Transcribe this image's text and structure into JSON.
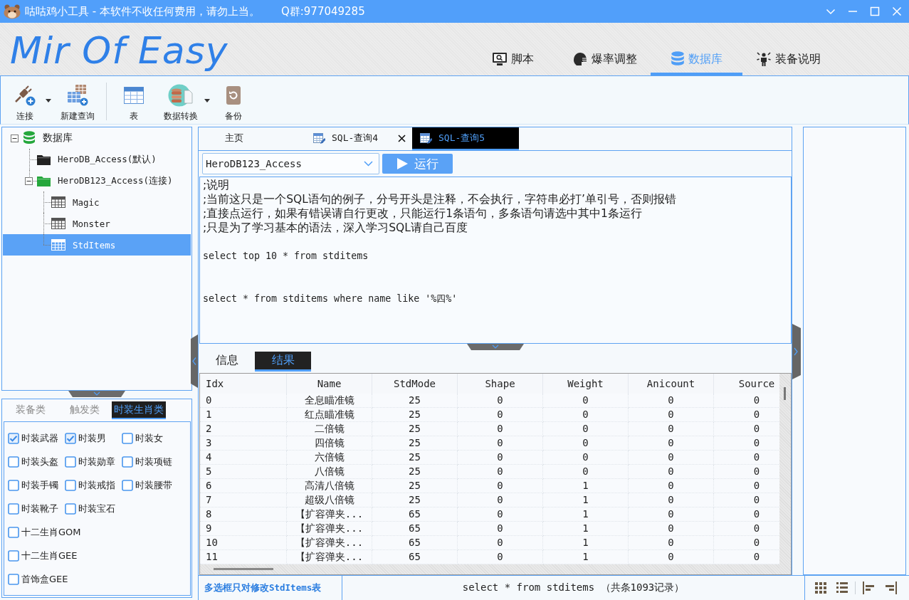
{
  "window": {
    "title": "咕咕鸡小工具 - 本软件不收任何费用，请勿上当。",
    "contact": "Q群:977049285"
  },
  "header": {
    "logo": "Mir Of Easy",
    "tabs": [
      {
        "label": "脚本",
        "selected": false
      },
      {
        "label": "爆率调整",
        "selected": false
      },
      {
        "label": "数据库",
        "selected": true
      },
      {
        "label": "装备说明",
        "selected": false
      }
    ]
  },
  "toolbar": {
    "groups": [
      [
        {
          "label": "连接",
          "dropdown": true
        },
        {
          "label": "新建查询",
          "dropdown": false
        }
      ],
      [
        {
          "label": "表",
          "dropdown": false
        },
        {
          "label": "数据转换",
          "dropdown": true
        },
        {
          "label": "备份",
          "dropdown": false
        }
      ]
    ]
  },
  "tree": [
    {
      "label": "数据库",
      "kind": "database",
      "expanded": true,
      "selected": false,
      "children": [
        {
          "label": "HeroDB_Access(默认)",
          "kind": "folder",
          "connected": false,
          "selected": false
        },
        {
          "label": "HeroDB123_Access(连接)",
          "kind": "folder",
          "connected": true,
          "expanded": true,
          "selected": false,
          "children": [
            {
              "label": "Magic",
              "kind": "table",
              "selected": false
            },
            {
              "label": "Monster",
              "kind": "table",
              "selected": false
            },
            {
              "label": "StdItems",
              "kind": "table",
              "selected": true
            }
          ]
        }
      ]
    }
  ],
  "filter_panel": {
    "tabs": [
      {
        "label": "装备类",
        "selected": false
      },
      {
        "label": "触发类",
        "selected": false
      },
      {
        "label": "时装生肖类",
        "selected": true
      }
    ],
    "options": [
      [
        {
          "label": "时装武器",
          "checked": true
        },
        {
          "label": "时装男",
          "checked": true
        },
        {
          "label": "时装女",
          "checked": false
        }
      ],
      [
        {
          "label": "时装头盔",
          "checked": false
        },
        {
          "label": "时装勋章",
          "checked": false
        },
        {
          "label": "时装项链",
          "checked": false
        }
      ],
      [
        {
          "label": "时装手镯",
          "checked": false
        },
        {
          "label": "时装戒指",
          "checked": false
        },
        {
          "label": "时装腰带",
          "checked": false
        }
      ],
      [
        {
          "label": "时装靴子",
          "checked": false
        },
        {
          "label": "时装宝石",
          "checked": false
        }
      ],
      [
        {
          "label": "十二生肖GOM",
          "checked": false
        }
      ],
      [
        {
          "label": "十二生肖GEE",
          "checked": false
        }
      ],
      [
        {
          "label": "首饰盒GEE",
          "checked": false
        }
      ]
    ]
  },
  "documents": {
    "tabs": [
      {
        "label": "主页",
        "kind": "home",
        "selected": false,
        "closable": false
      },
      {
        "label": "SQL-查询4",
        "kind": "query",
        "selected": false,
        "closable": true
      },
      {
        "label": "SQL-查询5",
        "kind": "query",
        "selected": true,
        "closable": false
      }
    ]
  },
  "query": {
    "database": "HeroDB123_Access",
    "run": "运行",
    "lines": [
      {
        "kind": "comment",
        "text": ";说明"
      },
      {
        "kind": "comment",
        "text": ";当前这只是一个SQL语句的例子，分号开头是注释，不会执行，字符串必打’单引号，否则报错"
      },
      {
        "kind": "comment",
        "text": ";直接点运行，如果有错误请自行更改，只能运行1条语句，多条语句请选中其中1条运行"
      },
      {
        "kind": "comment",
        "text": ";只是为了学习基本的语法，深入学习SQL请自己百度"
      },
      {
        "kind": "blank"
      },
      {
        "kind": "code",
        "text": "select top 10 * from stditems"
      },
      {
        "kind": "blank"
      },
      {
        "kind": "blank"
      },
      {
        "kind": "code",
        "text": "select * from stditems where name like '%四%'"
      }
    ]
  },
  "results": {
    "tabs": [
      {
        "label": "信息",
        "selected": false
      },
      {
        "label": "结果",
        "selected": true
      }
    ],
    "table": {
      "columns": [
        "Idx",
        "Name",
        "StdMode",
        "Shape",
        "Weight",
        "Anicount",
        "Source"
      ],
      "rows": [
        [
          "0",
          "全息瞄准镜",
          "25",
          "0",
          "0",
          "0",
          "0"
        ],
        [
          "1",
          "红点瞄准镜",
          "25",
          "0",
          "0",
          "0",
          "0"
        ],
        [
          "2",
          "二倍镜",
          "25",
          "0",
          "0",
          "0",
          "0"
        ],
        [
          "3",
          "四倍镜",
          "25",
          "0",
          "0",
          "0",
          "0"
        ],
        [
          "4",
          "六倍镜",
          "25",
          "0",
          "0",
          "0",
          "0"
        ],
        [
          "5",
          "八倍镜",
          "25",
          "0",
          "0",
          "0",
          "0"
        ],
        [
          "6",
          "高清八倍镜",
          "25",
          "0",
          "1",
          "0",
          "0"
        ],
        [
          "7",
          "超级八倍镜",
          "25",
          "0",
          "1",
          "0",
          "0"
        ],
        [
          "8",
          "【扩容弹夹...",
          "65",
          "0",
          "1",
          "0",
          "0"
        ],
        [
          "9",
          "【扩容弹夹...",
          "65",
          "0",
          "1",
          "0",
          "0"
        ],
        [
          "10",
          "【扩容弹夹...",
          "65",
          "0",
          "1",
          "0",
          "0"
        ],
        [
          "11",
          "【扩容弹夹...",
          "65",
          "0",
          "1",
          "0",
          "0"
        ]
      ]
    }
  },
  "status_bar": {
    "hint": "多选框只对修改StdItems表",
    "summary": "select * from stditems （共条1093记录）"
  }
}
